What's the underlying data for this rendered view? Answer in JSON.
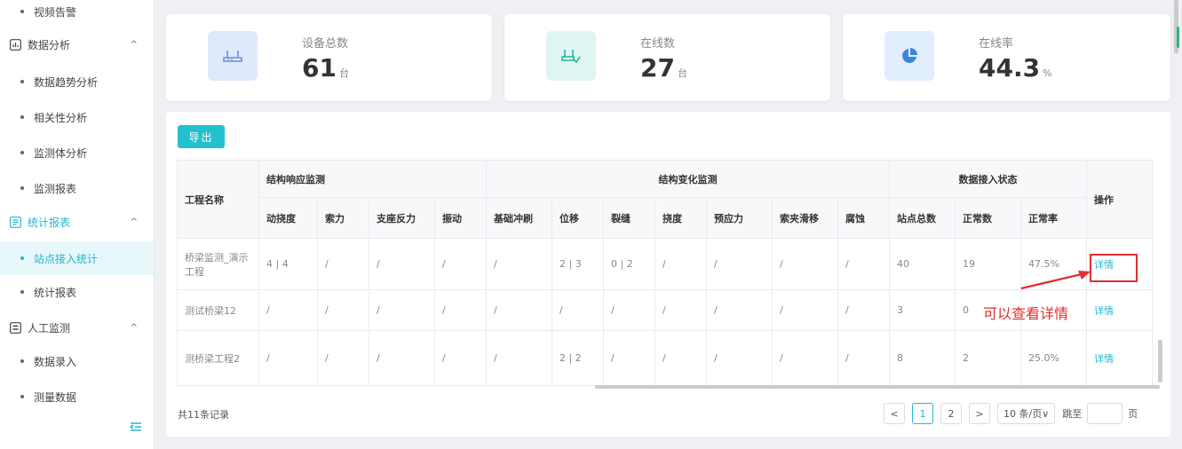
{
  "sidebar": {
    "items": [
      {
        "type": "sub",
        "label": "视频告警"
      },
      {
        "type": "group",
        "label": "数据分析",
        "icon": "chart-icon"
      },
      {
        "type": "sub",
        "label": "数据趋势分析"
      },
      {
        "type": "sub",
        "label": "相关性分析"
      },
      {
        "type": "sub",
        "label": "监测体分析"
      },
      {
        "type": "sub",
        "label": "监测报表"
      },
      {
        "type": "group",
        "label": "统计报表",
        "icon": "report-icon",
        "highlight": true
      },
      {
        "type": "sub",
        "label": "站点接入统计",
        "active": true
      },
      {
        "type": "sub",
        "label": "统计报表"
      },
      {
        "type": "group",
        "label": "人工监测",
        "icon": "manual-icon"
      },
      {
        "type": "sub",
        "label": "数据录入"
      },
      {
        "type": "sub",
        "label": "测量数据"
      }
    ],
    "caret": "^"
  },
  "cards": [
    {
      "label": "设备总数",
      "value": "61",
      "unit": "台",
      "icon": "router-icon",
      "color": "#dfe9fb"
    },
    {
      "label": "在线数",
      "value": "27",
      "unit": "台",
      "icon": "router-online-icon",
      "color": "#dff5f2"
    },
    {
      "label": "在线率",
      "value": "44.3",
      "unit": "%",
      "icon": "pie-icon",
      "color": "#e1eefb"
    }
  ],
  "toolbar": {
    "export_label": "导出"
  },
  "table": {
    "name_header": "工程名称",
    "groups": [
      "结构响应监测",
      "结构变化监测",
      "数据接入状态"
    ],
    "op_header": "操作",
    "columns": [
      "动挠度",
      "索力",
      "支座反力",
      "振动",
      "基础冲刷",
      "位移",
      "裂缝",
      "挠度",
      "预应力",
      "索夹滑移",
      "腐蚀",
      "站点总数",
      "正常数",
      "正常率"
    ],
    "rows": [
      {
        "name": "桥梁监测_演示工程",
        "cells": [
          "4 | 4",
          "/",
          "/",
          "/",
          "/",
          "2 | 3",
          "0 | 2",
          "/",
          "/",
          "/",
          "/",
          "40",
          "19",
          "47.5%"
        ],
        "op": "详情"
      },
      {
        "name": "测试桥梁12",
        "cells": [
          "/",
          "/",
          "/",
          "/",
          "/",
          "/",
          "/",
          "/",
          "/",
          "/",
          "/",
          "3",
          "0",
          "可以查看详情"
        ],
        "op": "详情"
      },
      {
        "name": "测桥梁工程2",
        "cells": [
          "/",
          "/",
          "/",
          "/",
          "/",
          "2 | 2",
          "/",
          "/",
          "/",
          "/",
          "/",
          "8",
          "2",
          "25.0%"
        ],
        "op": "详情"
      }
    ]
  },
  "annotation": "可以查看详情",
  "footer": {
    "total": "共11条记录",
    "pages": [
      "1",
      "2"
    ],
    "prev": "<",
    "next": ">",
    "page_size": "10 条/页∨",
    "jump_label": "跳至",
    "page_suffix": "页"
  }
}
